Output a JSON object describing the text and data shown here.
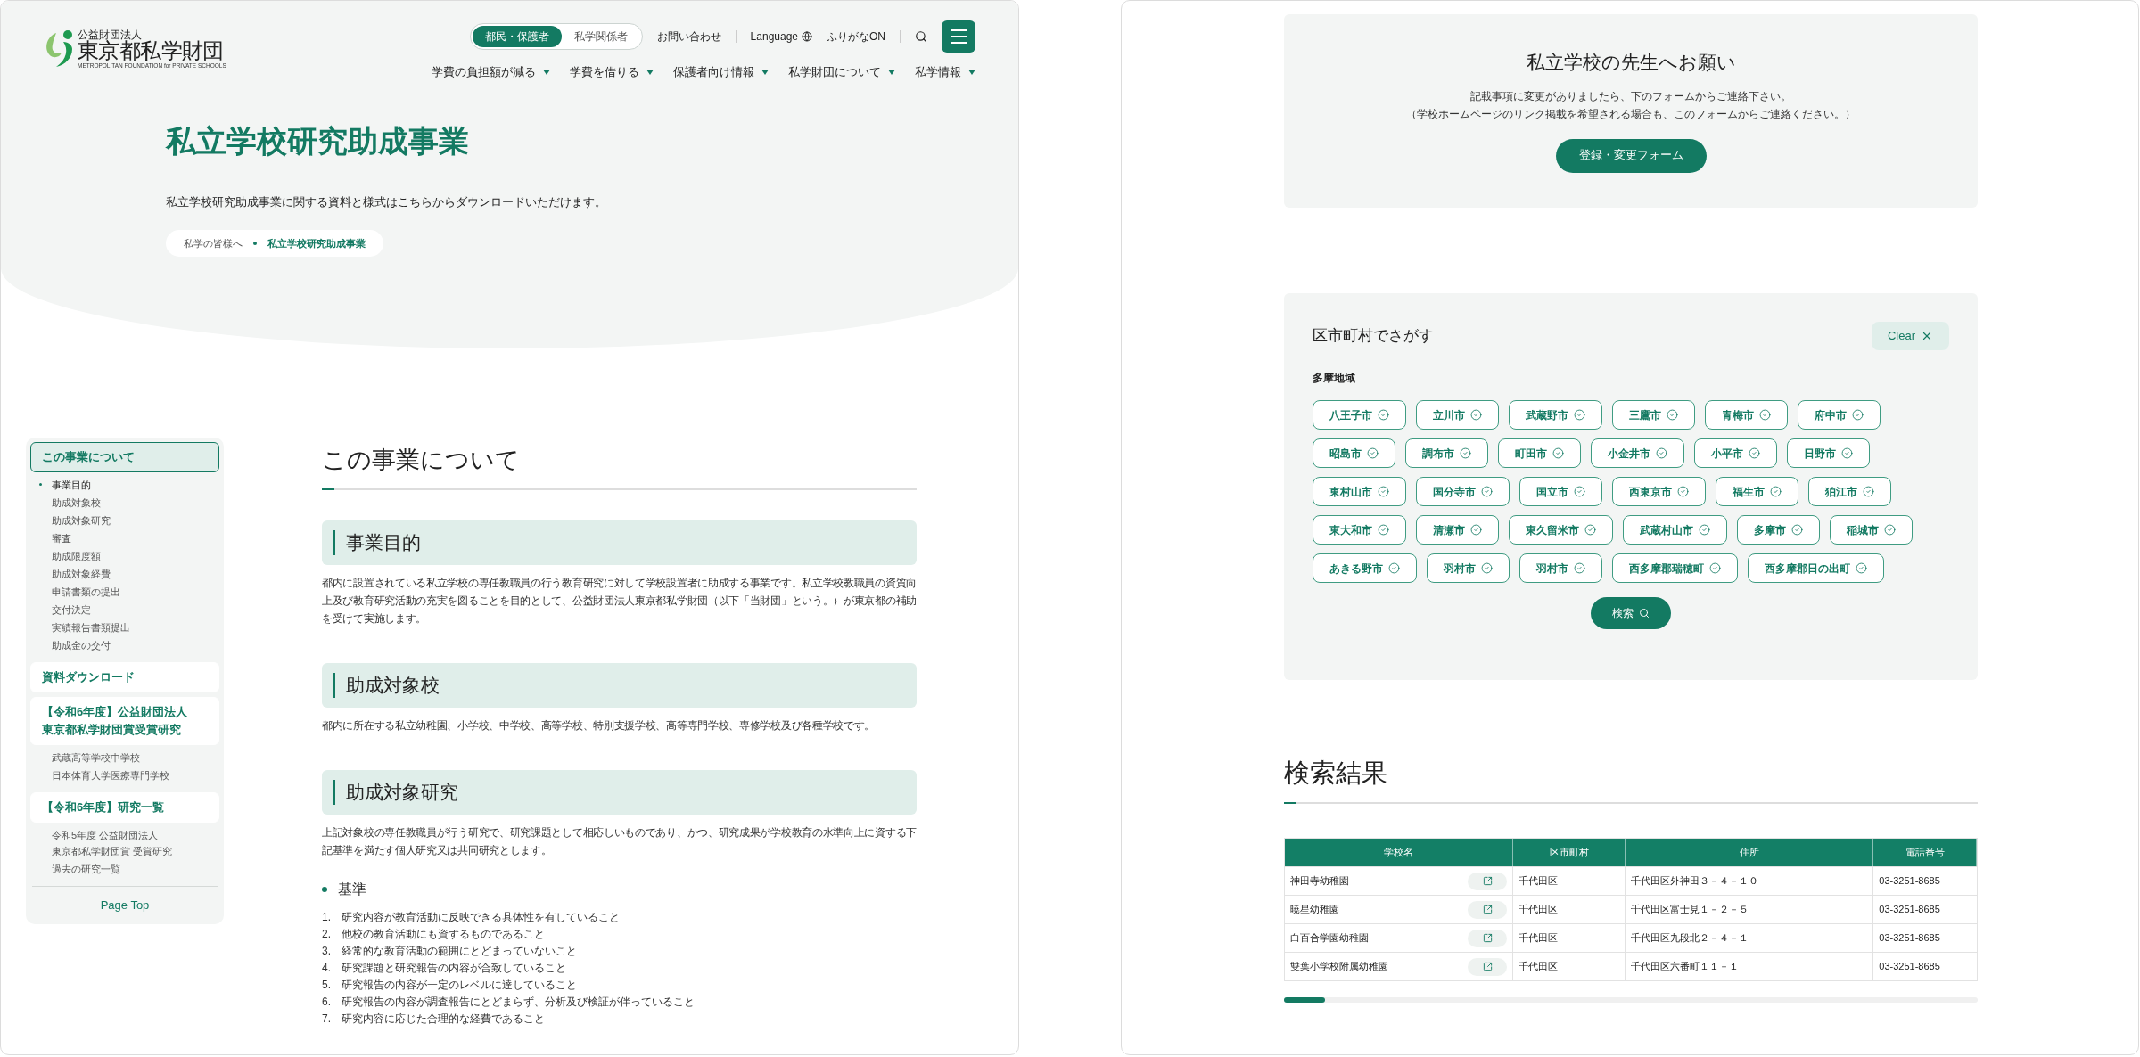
{
  "header": {
    "logo": {
      "org_type": "公益財団法人",
      "name": "東京都私学財団",
      "english": "METROPOLITAN FOUNDATION for PRIVATE SCHOOLS"
    },
    "audience_tabs": [
      {
        "label": "都民・保護者",
        "selected": true
      },
      {
        "label": "私学関係者",
        "selected": false
      }
    ],
    "contact": "お問い合わせ",
    "language": "Language",
    "furigana": "ふりがなON",
    "nav": [
      "学費の負担額が減る",
      "学費を借りる",
      "保護者向け情報",
      "私学財団について",
      "私学情報"
    ]
  },
  "hero": {
    "title": "私立学校研究助成事業",
    "lead": "私立学校研究助成事業に関する資料と様式はこちらからダウンロードいただけます。",
    "breadcrumb": [
      {
        "label": "私学の皆様へ",
        "current": false
      },
      {
        "label": "私立学校研究助成事業",
        "current": true
      }
    ]
  },
  "sidebar": {
    "sections": [
      {
        "label": "この事業について",
        "selected": true,
        "children": [
          {
            "label": "事業目的",
            "selected": true
          },
          {
            "label": "助成対象校",
            "selected": false
          },
          {
            "label": "助成対象研究",
            "selected": false
          },
          {
            "label": "審査",
            "selected": false
          },
          {
            "label": "助成限度額",
            "selected": false
          },
          {
            "label": "助成対象経費",
            "selected": false
          },
          {
            "label": "申請書類の提出",
            "selected": false
          },
          {
            "label": "交付決定",
            "selected": false
          },
          {
            "label": "実績報告書類提出",
            "selected": false
          },
          {
            "label": "助成金の交付",
            "selected": false
          }
        ]
      },
      {
        "label": "資料ダウンロード",
        "selected": false
      },
      {
        "lines": [
          "【令和6年度】公益財団法人",
          "東京都私学財団賞受賞研究"
        ],
        "selected": false,
        "children": [
          {
            "label": "武蔵高等学校中学校",
            "selected": false
          },
          {
            "label": "日本体育大学医療専門学校",
            "selected": false
          }
        ]
      },
      {
        "label": "【令和6年度】研究一覧",
        "selected": false,
        "children": [
          {
            "lines": [
              "令和5年度 公益財団法人",
              "東京都私学財団賞 受賞研究"
            ],
            "selected": false
          },
          {
            "label": "過去の研究一覧",
            "selected": false
          }
        ]
      }
    ],
    "page_top": "Page Top"
  },
  "content": {
    "heading": "この事業について",
    "sections": [
      {
        "heading": "事業目的",
        "body": "都内に設置されている私立学校の専任教職員の行う教育研究に対して学校設置者に助成する事業です。私立学校教職員の資質向上及び教育研究活動の充実を図ることを目的として、公益財団法人東京都私学財団（以下「当財団」という。）が東京都の補助を受けて実施します。"
      },
      {
        "heading": "助成対象校",
        "body": "都内に所在する私立幼稚園、小学校、中学校、高等学校、特別支援学校、高等専門学校、専修学校及び各種学校です。"
      },
      {
        "heading": "助成対象研究",
        "body": "上記対象校の専任教職員が行う研究で、研究課題として相応しいものであり、かつ、研究成果が学校教育の水準向上に資する下記基準を満たす個人研究又は共同研究とします。"
      }
    ],
    "criteria": {
      "heading": "基準",
      "items": [
        {
          "number": "1.",
          "text": "研究内容が教育活動に反映できる具体性を有していること"
        },
        {
          "number": "2.",
          "text": "他校の教育活動にも資するものであること"
        },
        {
          "number": "3.",
          "text": "経常的な教育活動の範囲にとどまっていないこと"
        },
        {
          "number": "4.",
          "text": "研究課題と研究報告の内容が合致していること"
        },
        {
          "number": "5.",
          "text": "研究報告の内容が一定のレベルに達していること"
        },
        {
          "number": "6.",
          "text": "研究報告の内容が調査報告にとどまらず、分析及び検証が伴っていること"
        },
        {
          "number": "7.",
          "text": "研究内容に応じた合理的な経費であること"
        }
      ]
    }
  },
  "notice": {
    "title": "私立学校の先生へお願い",
    "lines": [
      "記載事項に変更がありましたら、下のフォームからご連絡下さい。",
      "（学校ホームページのリンク掲載を希望される場合も、このフォームからご連絡ください。）"
    ],
    "button": "登録・変更フォーム"
  },
  "search": {
    "title": "区市町村でさがす",
    "clear": "Clear",
    "region": "多摩地域",
    "municipalities": [
      "八王子市",
      "立川市",
      "武蔵野市",
      "三鷹市",
      "青梅市",
      "府中市",
      "昭島市",
      "調布市",
      "町田市",
      "小金井市",
      "小平市",
      "日野市",
      "東村山市",
      "国分寺市",
      "国立市",
      "西東京市",
      "福生市",
      "狛江市",
      "東大和市",
      "清瀬市",
      "東久留米市",
      "武蔵村山市",
      "多摩市",
      "稲城市",
      "あきる野市",
      "羽村市",
      "羽村市",
      "西多摩郡瑞穂町",
      "西多摩郡日の出町"
    ],
    "button": "検索"
  },
  "results": {
    "title": "検索結果",
    "columns": [
      "学校名",
      "区市町村",
      "住所",
      "電話番号"
    ],
    "rows": [
      {
        "name": "神田寺幼稚園",
        "city": "千代田区",
        "address": "千代田区外神田３－４－１０",
        "phone": "03-3251-8685"
      },
      {
        "name": "暁星幼稚園",
        "city": "千代田区",
        "address": "千代田区富士見１－２－５",
        "phone": "03-3251-8685"
      },
      {
        "name": "白百合学園幼稚園",
        "city": "千代田区",
        "address": "千代田区九段北２－４－１",
        "phone": "03-3251-8685"
      },
      {
        "name": "雙葉小学校附属幼稚園",
        "city": "千代田区",
        "address": "千代田区六番町１１－１",
        "phone": "03-3251-8685"
      }
    ]
  }
}
